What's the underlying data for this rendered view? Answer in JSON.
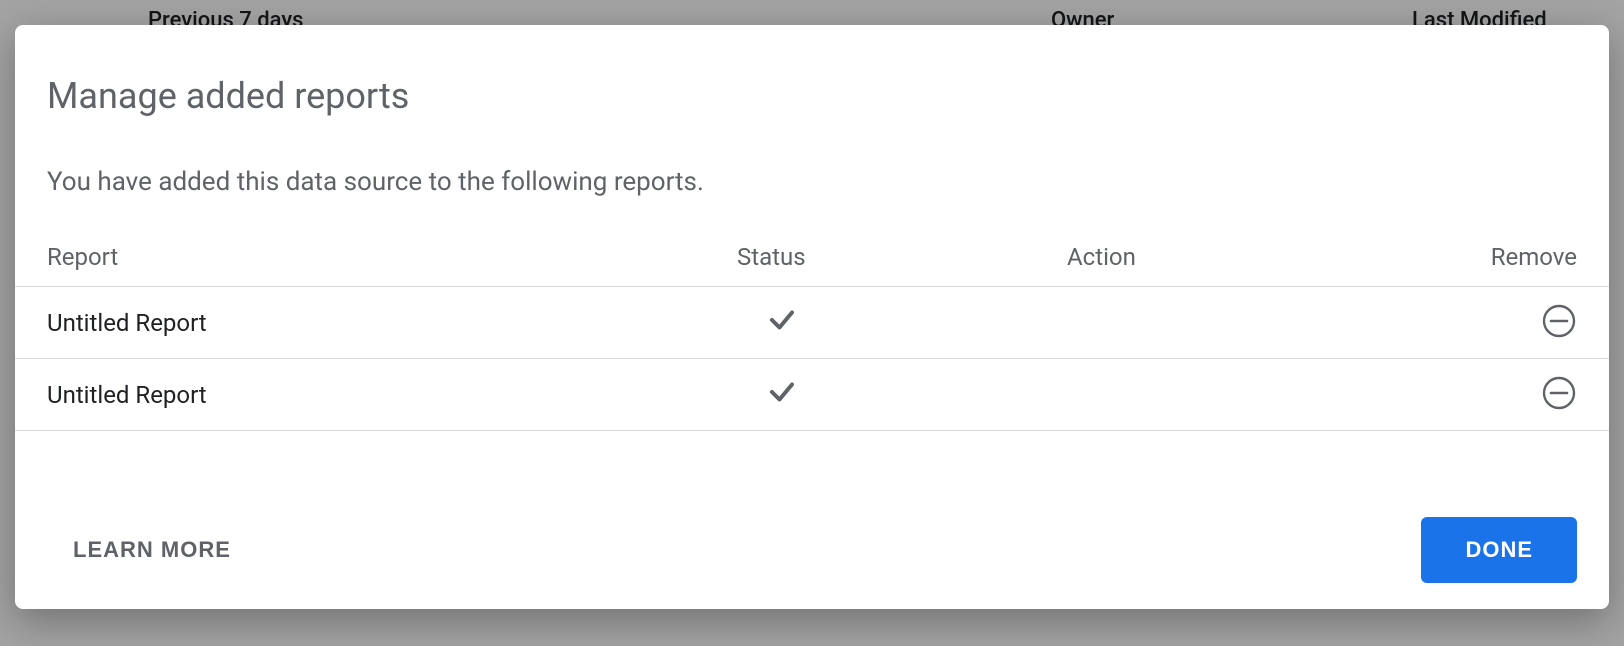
{
  "background": {
    "section_label": "Previous 7 days",
    "col_owner": "Owner",
    "col_last_modified": "Last Modified"
  },
  "dialog": {
    "title": "Manage added reports",
    "subtitle": "You have added this data source to the following reports.",
    "columns": {
      "report": "Report",
      "status": "Status",
      "action": "Action",
      "remove": "Remove"
    },
    "rows": [
      {
        "name": "Untitled Report",
        "status": "ok"
      },
      {
        "name": "Untitled Report",
        "status": "ok"
      }
    ],
    "learn_more_label": "LEARN MORE",
    "done_label": "DONE"
  }
}
